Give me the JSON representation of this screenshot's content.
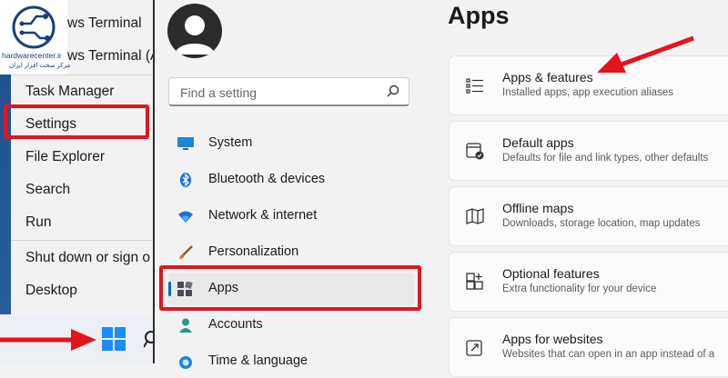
{
  "watermark": {
    "site": "hardwarecenter.ir",
    "tagline": "مرکز سخت افزار ایران"
  },
  "context_menu": {
    "partial_items": [
      "ws Terminal",
      "ws Terminal (A"
    ],
    "items": [
      {
        "label": "Task Manager"
      },
      {
        "label": "Settings"
      },
      {
        "label": "File Explorer"
      },
      {
        "label": "Search"
      },
      {
        "label": "Run"
      },
      {
        "label": "Shut down or sign o"
      },
      {
        "label": "Desktop"
      }
    ]
  },
  "settings": {
    "search_placeholder": "Find a setting",
    "nav": [
      {
        "label": "System",
        "icon": "monitor-icon"
      },
      {
        "label": "Bluetooth & devices",
        "icon": "bluetooth-icon"
      },
      {
        "label": "Network & internet",
        "icon": "wifi-icon"
      },
      {
        "label": "Personalization",
        "icon": "brush-icon"
      },
      {
        "label": "Apps",
        "icon": "apps-icon",
        "selected": true
      },
      {
        "label": "Accounts",
        "icon": "person-icon"
      },
      {
        "label": "Time & language",
        "icon": "globe-clock-icon"
      }
    ],
    "page_title": "Apps",
    "cards": [
      {
        "title": "Apps & features",
        "subtitle": "Installed apps, app execution aliases",
        "icon": "list-icon"
      },
      {
        "title": "Default apps",
        "subtitle": "Defaults for file and link types, other defaults",
        "icon": "default-app-icon"
      },
      {
        "title": "Offline maps",
        "subtitle": "Downloads, storage location, map updates",
        "icon": "map-icon"
      },
      {
        "title": "Optional features",
        "subtitle": "Extra functionality for your device",
        "icon": "grid-plus-icon"
      },
      {
        "title": "Apps for websites",
        "subtitle": "Websites that can open in an app instead of a",
        "icon": "open-external-icon"
      }
    ]
  },
  "colors": {
    "highlight": "#e4141c",
    "accent": "#0067c0",
    "taskbar_blue": "#1e4f86"
  }
}
